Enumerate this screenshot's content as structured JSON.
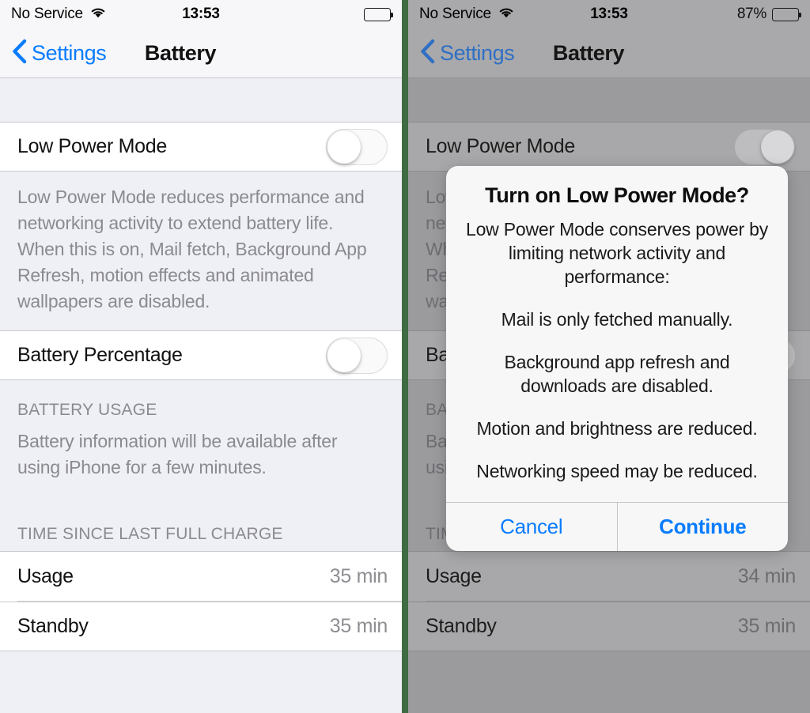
{
  "left": {
    "status_bar": {
      "carrier": "No Service",
      "wifi_icon": "wifi-icon",
      "time": "13:53",
      "battery_percent_label": "",
      "battery_icon": "battery-full-icon",
      "battery_level": 100,
      "battery_color": "#000000"
    },
    "nav": {
      "back_icon": "chevron-left-icon",
      "back_label": "Settings",
      "title": "Battery"
    },
    "low_power_mode": {
      "label": "Low Power Mode",
      "toggle_on": false,
      "toggle_icon": "switch-off-icon"
    },
    "low_power_footer": "Low Power Mode reduces performance and networking activity to extend battery life.  When this is on, Mail fetch, Background App Refresh, motion effects and animated wallpapers are disabled.",
    "battery_percentage": {
      "label": "Battery Percentage",
      "toggle_on": false,
      "toggle_icon": "switch-off-icon"
    },
    "battery_usage_header": "BATTERY USAGE",
    "battery_usage_footer": "Battery information will be available after using iPhone for a few minutes.",
    "time_since_header": "TIME SINCE LAST FULL CHARGE",
    "usage": {
      "label": "Usage",
      "value": "35 min"
    },
    "standby": {
      "label": "Standby",
      "value": "35 min"
    }
  },
  "right": {
    "status_bar": {
      "carrier": "No Service",
      "wifi_icon": "wifi-icon",
      "time": "13:53",
      "battery_percent_label": "87%",
      "battery_icon": "battery-low-power-icon",
      "battery_level": 87,
      "battery_color": "#c8a41e"
    },
    "nav": {
      "back_icon": "chevron-left-icon",
      "back_label": "Settings",
      "title": "Battery"
    },
    "low_power_mode": {
      "label": "Low Power Mode",
      "toggle_on": true,
      "toggle_icon": "switch-on-icon"
    },
    "low_power_footer": "Low Power Mode reduces performance and networking activity to extend battery life.  When this is on, Mail fetch, Background App Refresh, motion effects and animated wallpapers are disabled.",
    "battery_percentage": {
      "label": "Battery Percentage",
      "toggle_on": false,
      "toggle_icon": "switch-off-icon"
    },
    "battery_usage_header": "BATTERY USAGE",
    "battery_usage_footer": "Battery information will be available after using iPhone for a few minutes.",
    "time_since_header": "TIME SINCE LAST FULL CHARGE",
    "usage": {
      "label": "Usage",
      "value": "34 min"
    },
    "standby": {
      "label": "Standby",
      "value": "35 min"
    },
    "modal": {
      "title": "Turn on Low Power Mode?",
      "intro": "Low Power Mode conserves power by limiting network activity and performance:",
      "lines": [
        "Mail is only fetched manually.",
        "Background app refresh and downloads are disabled.",
        "Motion and brightness are reduced.",
        "Networking speed may be reduced."
      ],
      "cancel_label": "Cancel",
      "continue_label": "Continue"
    }
  },
  "theme": {
    "ios_blue": "#0a7cff",
    "toggle_on_green": "#4cd964",
    "group_background": "#eff0f5",
    "cell_background": "#ffffff",
    "secondary_text": "#8a8a8f",
    "divider_green": "#3f6b43"
  }
}
